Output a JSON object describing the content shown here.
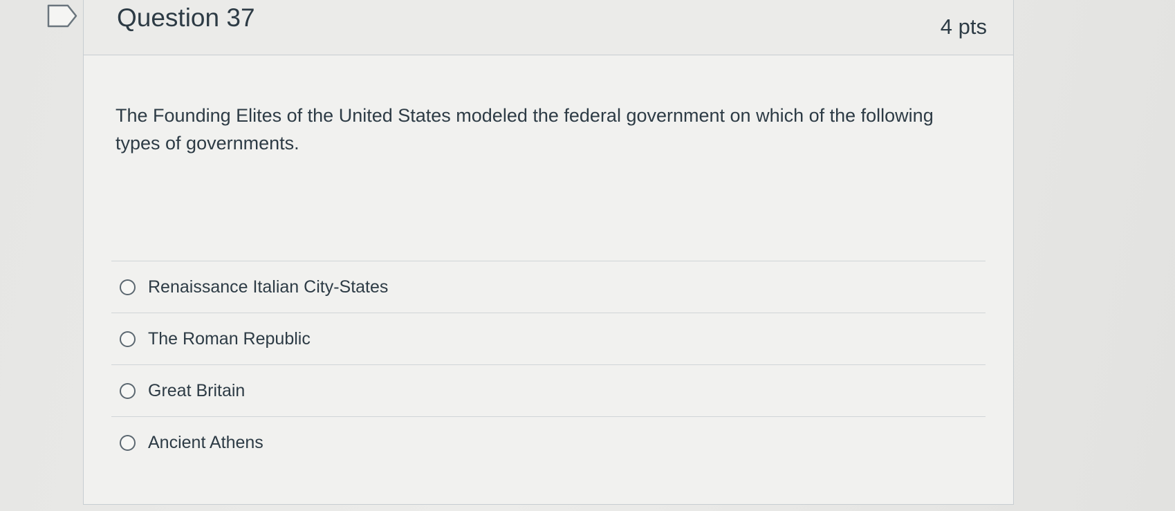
{
  "question": {
    "title": "Question 37",
    "points": "4 pts",
    "text": "The Founding Elites of the United States modeled the federal government on which of the following types of governments.",
    "bookmark_icon": "bookmark-flag-icon"
  },
  "answers": [
    {
      "label": "Renaissance Italian City-States"
    },
    {
      "label": "The Roman Republic"
    },
    {
      "label": "Great Britain"
    },
    {
      "label": "Ancient Athens"
    }
  ],
  "colors": {
    "text": "#2d3b45",
    "border": "#c7cdd1",
    "header_bg": "#ebebe9",
    "card_bg": "#f1f1ef"
  }
}
